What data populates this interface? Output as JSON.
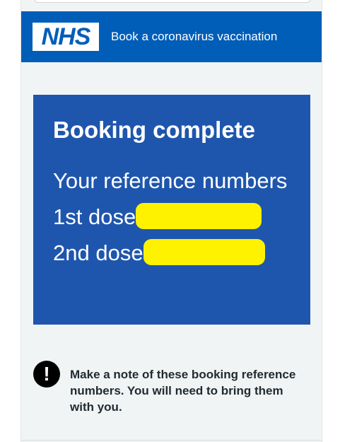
{
  "header": {
    "logo_text": "NHS",
    "service_name": "Book a coronavirus vaccination"
  },
  "confirmation": {
    "title": "Booking complete",
    "subtitle": "Your reference numbers",
    "first_dose_label": "1st dose",
    "second_dose_label": "2nd dose"
  },
  "warning": {
    "icon": "exclamation-icon",
    "text": "Make a note of these booking reference numbers. You will need to bring them with you."
  },
  "colors": {
    "nhs_blue": "#005eb8",
    "panel_blue": "#1f56ad",
    "redaction_yellow": "#fff200",
    "background": "#f0f4f5"
  }
}
